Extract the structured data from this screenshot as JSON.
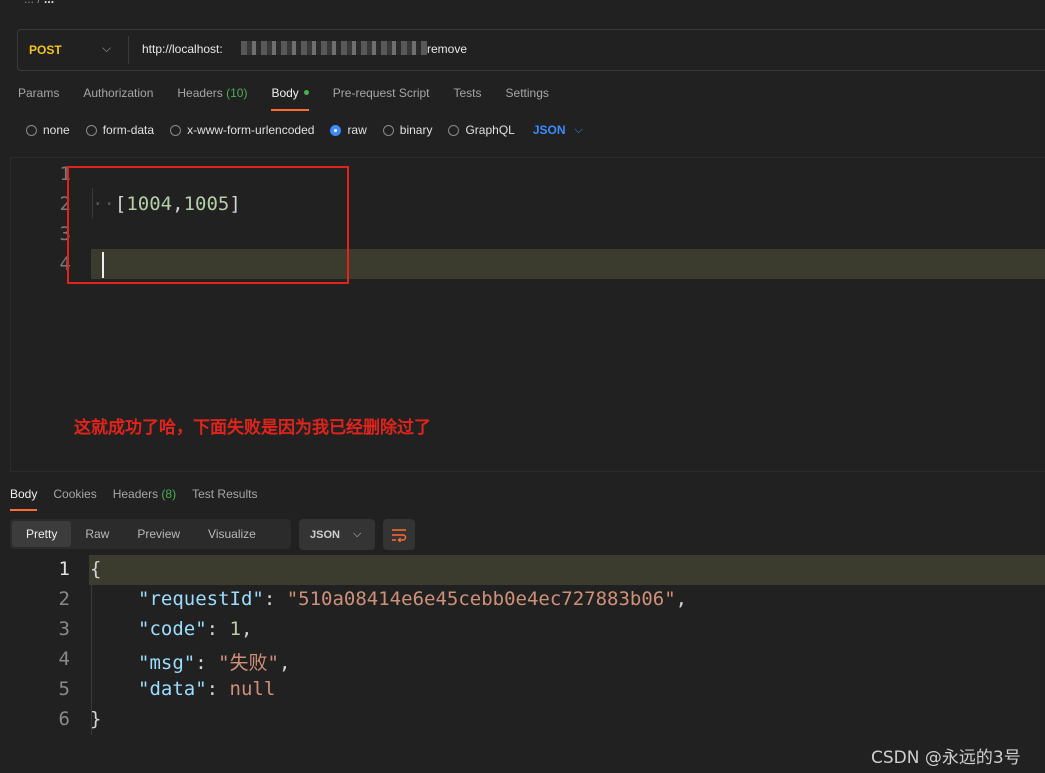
{
  "breadcrumb": {
    "parent": "...",
    "current": "..."
  },
  "request": {
    "method": "POST",
    "url_prefix": "http://localhost:",
    "url_suffix": "remove"
  },
  "request_tabs": [
    {
      "label": "Params"
    },
    {
      "label": "Authorization"
    },
    {
      "label": "Headers",
      "count": "(10)"
    },
    {
      "label": "Body",
      "active": true
    },
    {
      "label": "Pre-request Script"
    },
    {
      "label": "Tests"
    },
    {
      "label": "Settings"
    }
  ],
  "body_types": [
    {
      "label": "none"
    },
    {
      "label": "form-data"
    },
    {
      "label": "x-www-form-urlencoded"
    },
    {
      "label": "raw",
      "checked": true
    },
    {
      "label": "binary"
    },
    {
      "label": "GraphQL"
    }
  ],
  "body_format": "JSON",
  "request_body": {
    "line_numbers": [
      "1",
      "2",
      "3",
      "4"
    ],
    "open_bracket": "[",
    "values": [
      "1004",
      "1005"
    ],
    "comma": ",",
    "close_bracket": "]"
  },
  "annotation": "这就成功了哈，下面失败是因为我已经删除过了",
  "response_tabs": [
    {
      "label": "Body",
      "active": true
    },
    {
      "label": "Cookies"
    },
    {
      "label": "Headers",
      "count": "(8)"
    },
    {
      "label": "Test Results"
    }
  ],
  "response_views": [
    "Pretty",
    "Raw",
    "Preview",
    "Visualize"
  ],
  "response_format": "JSON",
  "response_body": {
    "line_numbers": [
      "1",
      "2",
      "3",
      "4",
      "5",
      "6"
    ],
    "open": "{",
    "close": "}",
    "fields": [
      {
        "key": "\"requestId\"",
        "value": "\"510a08414e6e45cebb0e4ec727883b06\"",
        "type": "string"
      },
      {
        "key": "\"code\"",
        "value": "1",
        "type": "number"
      },
      {
        "key": "\"msg\"",
        "value": "\"失败\"",
        "type": "string"
      },
      {
        "key": "\"data\"",
        "value": "null",
        "type": "null"
      }
    ]
  },
  "watermark": "CSDN @永远的3号",
  "colors": {
    "method": "#f5c518",
    "accent_tab": "#ff6c37",
    "count_green": "#4caf50",
    "format_blue": "#3d8bfd",
    "annotation_red": "#e0241b",
    "json_key": "#9cdcfe",
    "json_string": "#ce9178",
    "json_number": "#b5cea8"
  }
}
